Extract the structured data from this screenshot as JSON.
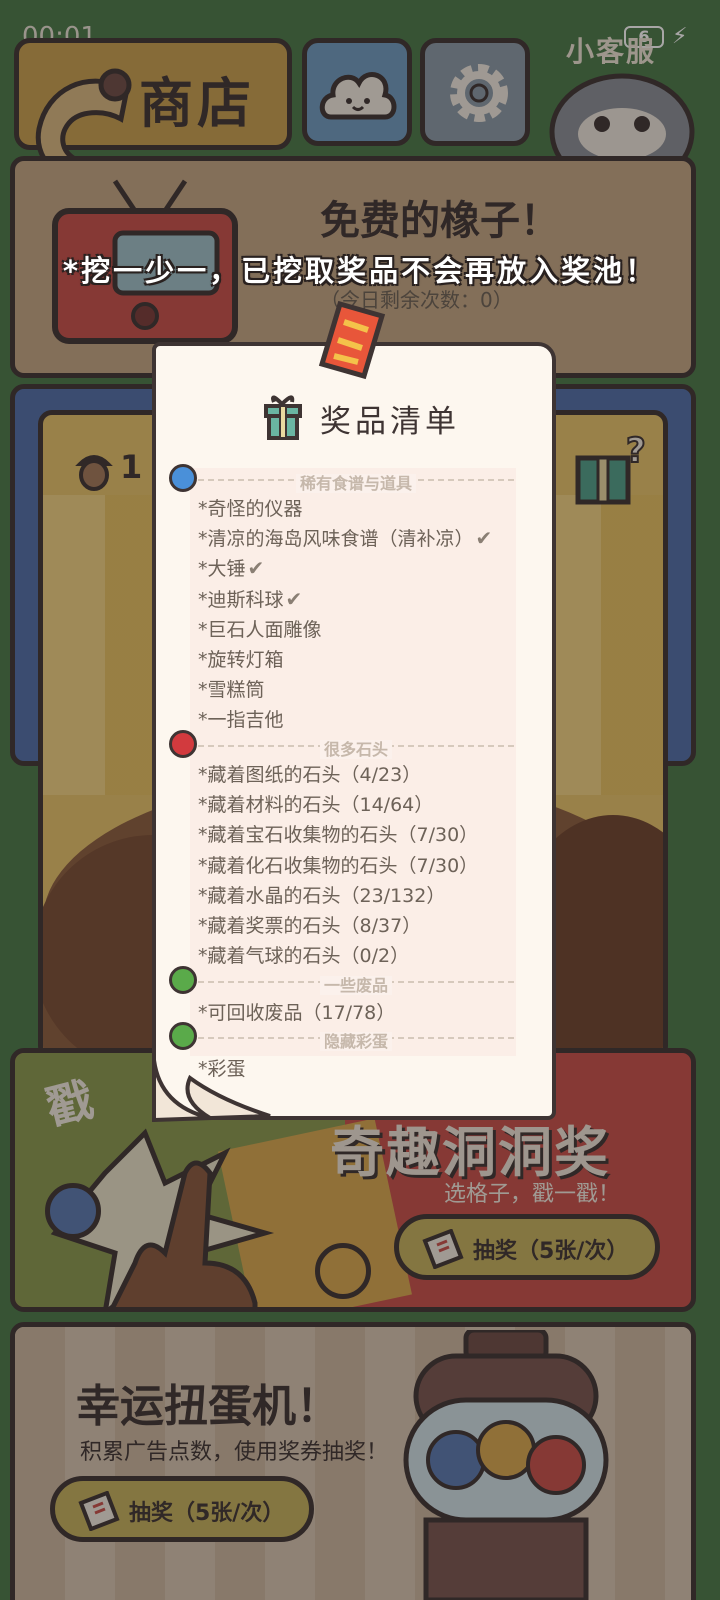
{
  "status_bar": {
    "time": "00:01",
    "battery": "6"
  },
  "top_bar": {
    "shop_label": "商店",
    "service_label": "小客服"
  },
  "free_acorns": {
    "title": "免费的橡子！",
    "remaining": "（今日剩余次数：0）"
  },
  "acorn_count": "1",
  "notice": "*挖一少一，已挖取奖品不会再放入奖池！",
  "prize_list": {
    "title": "奖品清单",
    "sections": [
      {
        "name": "稀有食谱与道具",
        "color": "#4a90d9",
        "items": [
          {
            "text": "*奇怪的仪器",
            "checked": false
          },
          {
            "text": "*清凉的海岛风味食谱（清补凉）",
            "checked": true
          },
          {
            "text": "*大锤",
            "checked": true
          },
          {
            "text": "*迪斯科球",
            "checked": true
          },
          {
            "text": "*巨石人面雕像",
            "checked": false
          },
          {
            "text": "*旋转灯箱",
            "checked": false
          },
          {
            "text": "*雪糕筒",
            "checked": false
          },
          {
            "text": "*一指吉他",
            "checked": false
          }
        ]
      },
      {
        "name": "很多石头",
        "color": "#d23a3e",
        "items": [
          {
            "text": "*藏着图纸的石头（4/23）",
            "checked": false
          },
          {
            "text": "*藏着材料的石头（14/64）",
            "checked": false
          },
          {
            "text": "*藏着宝石收集物的石头（7/30）",
            "checked": false
          },
          {
            "text": "*藏着化石收集物的石头（7/30）",
            "checked": false
          },
          {
            "text": "*藏着水晶的石头（23/132）",
            "checked": false
          },
          {
            "text": "*藏着奖票的石头（8/37）",
            "checked": false
          },
          {
            "text": "*藏着气球的石头（0/2）",
            "checked": false
          }
        ]
      },
      {
        "name": "一些废品",
        "color": "#5aaa4a",
        "items": [
          {
            "text": "*可回收废品（17/78）",
            "checked": false
          }
        ]
      },
      {
        "name": "隐藏彩蛋",
        "color": "#5aaa4a",
        "items": [
          {
            "text": "*彩蛋",
            "checked": false
          }
        ]
      }
    ]
  },
  "lottery": {
    "poke_label": "戳",
    "title": "奇趣洞洞奖",
    "subtitle": "选格子，戳一戳！",
    "button_label": "抽奖（5张/次）"
  },
  "gacha": {
    "title": "幸运扭蛋机！",
    "subtitle": "积累广告点数，使用奖券抽奖！",
    "button_label": "抽奖（5张/次）"
  }
}
